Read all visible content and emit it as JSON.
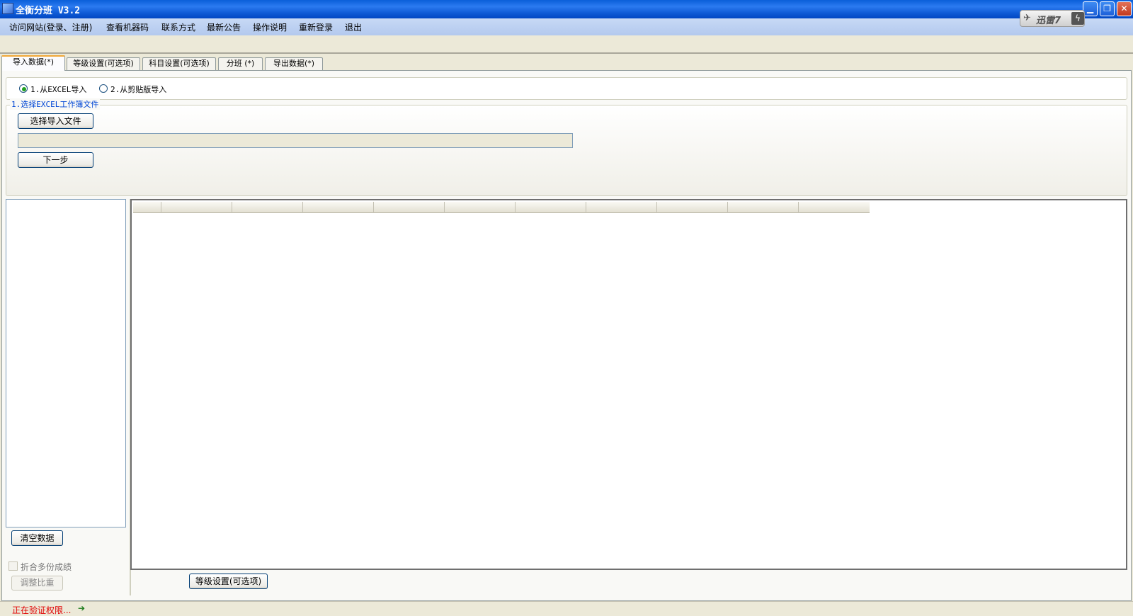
{
  "window": {
    "title": "全衡分班 V3.2"
  },
  "window_controls": {
    "minimize": "▁",
    "restore": "❐",
    "close": "✕"
  },
  "xunlei": {
    "label": "迅雷7",
    "bird_icon": "✈",
    "bolt_icon": "ϟ"
  },
  "menu": [
    "访问网站(登录、注册)",
    "查看机器码",
    "联系方式",
    "最新公告",
    "操作说明",
    "重新登录",
    "退出"
  ],
  "tabs": [
    {
      "label": "导入数据(*)",
      "active": true
    },
    {
      "label": "等级设置(可选项)",
      "active": false
    },
    {
      "label": "科目设置(可选项)",
      "active": false
    },
    {
      "label": "分班 (*)",
      "active": false
    },
    {
      "label": "导出数据(*)",
      "active": false
    }
  ],
  "import_source": {
    "options": [
      {
        "label": "1.从EXCEL导入",
        "selected": true
      },
      {
        "label": "2.从剪贴版导入",
        "selected": false
      }
    ]
  },
  "file_group": {
    "legend": "1.选择EXCEL工作簿文件",
    "choose_button": "选择导入文件",
    "path_value": "",
    "next_button": "下一步"
  },
  "left_panel": {
    "clear_button": "清空数据",
    "merge_checkbox_label": "折合多份成绩",
    "merge_checked": false,
    "adjust_button": "调整比重"
  },
  "grid": {
    "columns": [
      "",
      "",
      "",
      "",
      "",
      "",
      "",
      "",
      "",
      "",
      ""
    ]
  },
  "bottom": {
    "level_button": "等级设置(可选项)"
  },
  "status": {
    "text": "正在验证权限...",
    "arrow_icon": "➔"
  },
  "colors": {
    "titlebar": "#0a5fd9",
    "menubar": "#c7d9f5",
    "status_text": "#e00000",
    "legend": "#0046d5",
    "active_tab_accent": "#f1a737"
  }
}
